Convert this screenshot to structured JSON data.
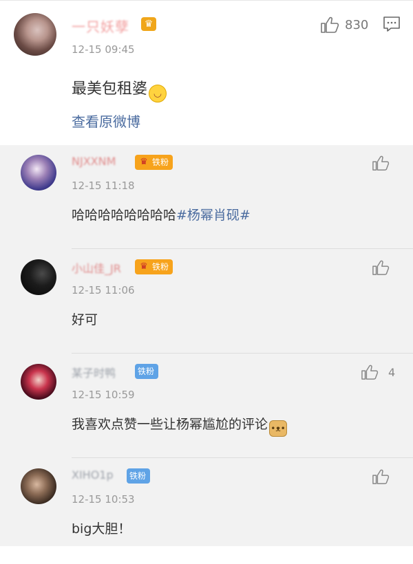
{
  "main_post": {
    "username": "一只妖孽",
    "time": "12-15 09:45",
    "text": "最美包租婆",
    "emoji": "blush-emoji",
    "view_link": "查看原微博",
    "like_count": "830"
  },
  "comments": [
    {
      "username": "NJXXNM",
      "badge": "铁粉",
      "badge_type": "orange",
      "time": "12-15 11:18",
      "text": "哈哈哈哈哈哈哈哈",
      "hashtag": "#杨幂肖砚#",
      "like_count": ""
    },
    {
      "username": "小山佳_JR",
      "badge": "铁粉",
      "badge_type": "orange",
      "time": "12-15 11:06",
      "text": "好可",
      "like_count": ""
    },
    {
      "username": "某子时鸭",
      "badge": "铁粉",
      "badge_type": "blue",
      "time": "12-15 10:59",
      "text": "我喜欢点赞一些让杨幂尴尬的评论",
      "like_count": "4"
    },
    {
      "username": "XIHO1p",
      "badge": "铁粉",
      "badge_type": "blue",
      "time": "12-15 10:53",
      "text": "big大胆！",
      "like_count": ""
    }
  ],
  "colors": {
    "link": "#4a6b9f",
    "badge_orange": "#f7a31c",
    "badge_blue": "#5fa3e6"
  }
}
